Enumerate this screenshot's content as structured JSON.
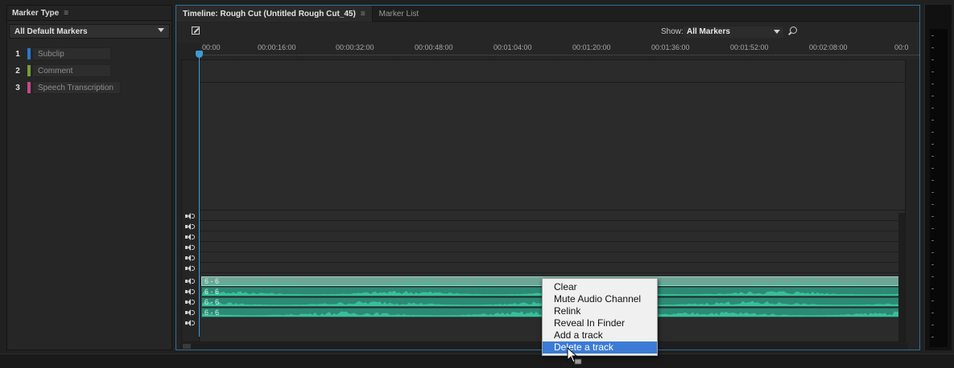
{
  "marker_panel": {
    "title": "Marker Type",
    "menu_glyph": "≡",
    "dropdown_value": "All Default Markers",
    "markers": [
      {
        "num": "1",
        "label": "Subclip",
        "color": "#2b78c9"
      },
      {
        "num": "2",
        "label": "Comment",
        "color": "#7a9a3a"
      },
      {
        "num": "3",
        "label": "Speech Transcription",
        "color": "#c24a86"
      }
    ]
  },
  "timeline": {
    "tabs": [
      {
        "label": "Timeline: Rough Cut (Untitled Rough Cut_45)",
        "menu_glyph": "≡"
      },
      {
        "label": "Marker List"
      }
    ],
    "show_label": "Show:",
    "show_value": "All Markers",
    "ruler_labels": [
      "00:00",
      "00:00:16:00",
      "00:00:32:00",
      "00:00:48:00",
      "00:01:04:00",
      "00:01:20:00",
      "00:01:36:00",
      "00:01:52:00",
      "00:02:08:00",
      "00:0"
    ],
    "audio_clips": [
      {
        "label": "6 - 6"
      },
      {
        "label": "6 - 6"
      },
      {
        "label": "6 - 6"
      },
      {
        "label": "6 - 6"
      }
    ],
    "accent_color": "#3d9bd6",
    "clip_color": "#2c8a74"
  },
  "context_menu": {
    "items": [
      "Clear",
      "Mute Audio Channel",
      "Relink",
      "Reveal In Finder",
      "Add a track",
      "Delete a track"
    ],
    "highlighted_index": 5
  },
  "icons": {
    "edit": "edit-icon",
    "search": "search-icon",
    "speaker": "speaker-icon",
    "cursor": "pointer-cursor-icon"
  }
}
